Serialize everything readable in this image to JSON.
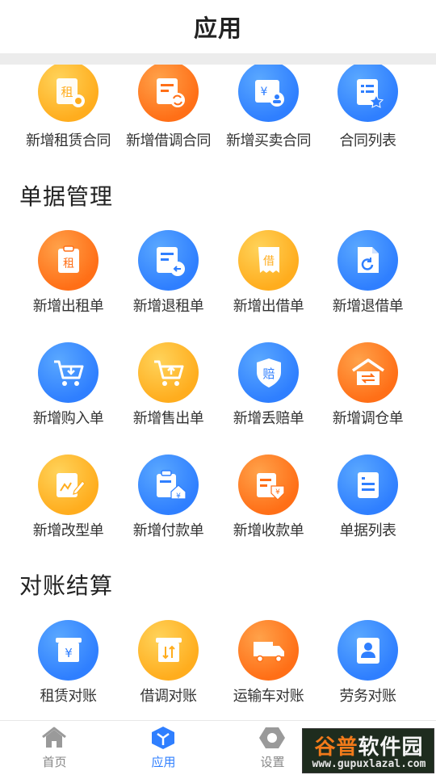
{
  "header": {
    "title": "应用"
  },
  "contracts": {
    "items": [
      {
        "label": "新增租赁合同",
        "icon": "rent-contract-icon",
        "color": "#ffad1e",
        "glyph": "租"
      },
      {
        "label": "新增借调合同",
        "icon": "borrow-contract-icon",
        "color": "#ff6f17",
        "glyph": ""
      },
      {
        "label": "新增买卖合同",
        "icon": "sale-contract-icon",
        "color": "#2f7fff",
        "glyph": "¥"
      },
      {
        "label": "合同列表",
        "icon": "contract-list-icon",
        "color": "#2f7fff",
        "glyph": ""
      }
    ]
  },
  "documents": {
    "title": "单据管理",
    "rows": [
      [
        {
          "label": "新增出租单",
          "icon": "rent-out-icon",
          "glyph": "租"
        },
        {
          "label": "新增退租单",
          "icon": "rent-return-icon",
          "glyph": ""
        },
        {
          "label": "新增出借单",
          "icon": "lend-out-icon",
          "glyph": "借"
        },
        {
          "label": "新增退借单",
          "icon": "lend-return-icon",
          "glyph": ""
        }
      ],
      [
        {
          "label": "新增购入单",
          "icon": "purchase-cart-icon",
          "glyph": ""
        },
        {
          "label": "新增售出单",
          "icon": "sell-cart-icon",
          "glyph": ""
        },
        {
          "label": "新增丢赔单",
          "icon": "loss-compensation-icon",
          "glyph": "赔"
        },
        {
          "label": "新增调仓单",
          "icon": "warehouse-transfer-icon",
          "glyph": ""
        }
      ],
      [
        {
          "label": "新增改型单",
          "icon": "modify-type-icon",
          "glyph": ""
        },
        {
          "label": "新增付款单",
          "icon": "payment-icon",
          "glyph": "¥"
        },
        {
          "label": "新增收款单",
          "icon": "receipt-icon",
          "glyph": "¥"
        },
        {
          "label": "单据列表",
          "icon": "document-list-icon",
          "glyph": ""
        }
      ]
    ]
  },
  "settlement": {
    "title": "对账结算",
    "items": [
      {
        "label": "租赁对账",
        "icon": "rent-reconcile-icon",
        "glyph": "¥"
      },
      {
        "label": "借调对账",
        "icon": "borrow-reconcile-icon",
        "glyph": ""
      },
      {
        "label": "运输车对账",
        "icon": "truck-reconcile-icon",
        "glyph": ""
      },
      {
        "label": "劳务对账",
        "icon": "labor-reconcile-icon",
        "glyph": ""
      }
    ]
  },
  "tabbar": {
    "home": "首页",
    "apps": "应用",
    "settings": "设置"
  },
  "watermark": {
    "brand_a": "谷普",
    "brand_b": "软件园",
    "url": "www.gupuxlazal.com"
  }
}
